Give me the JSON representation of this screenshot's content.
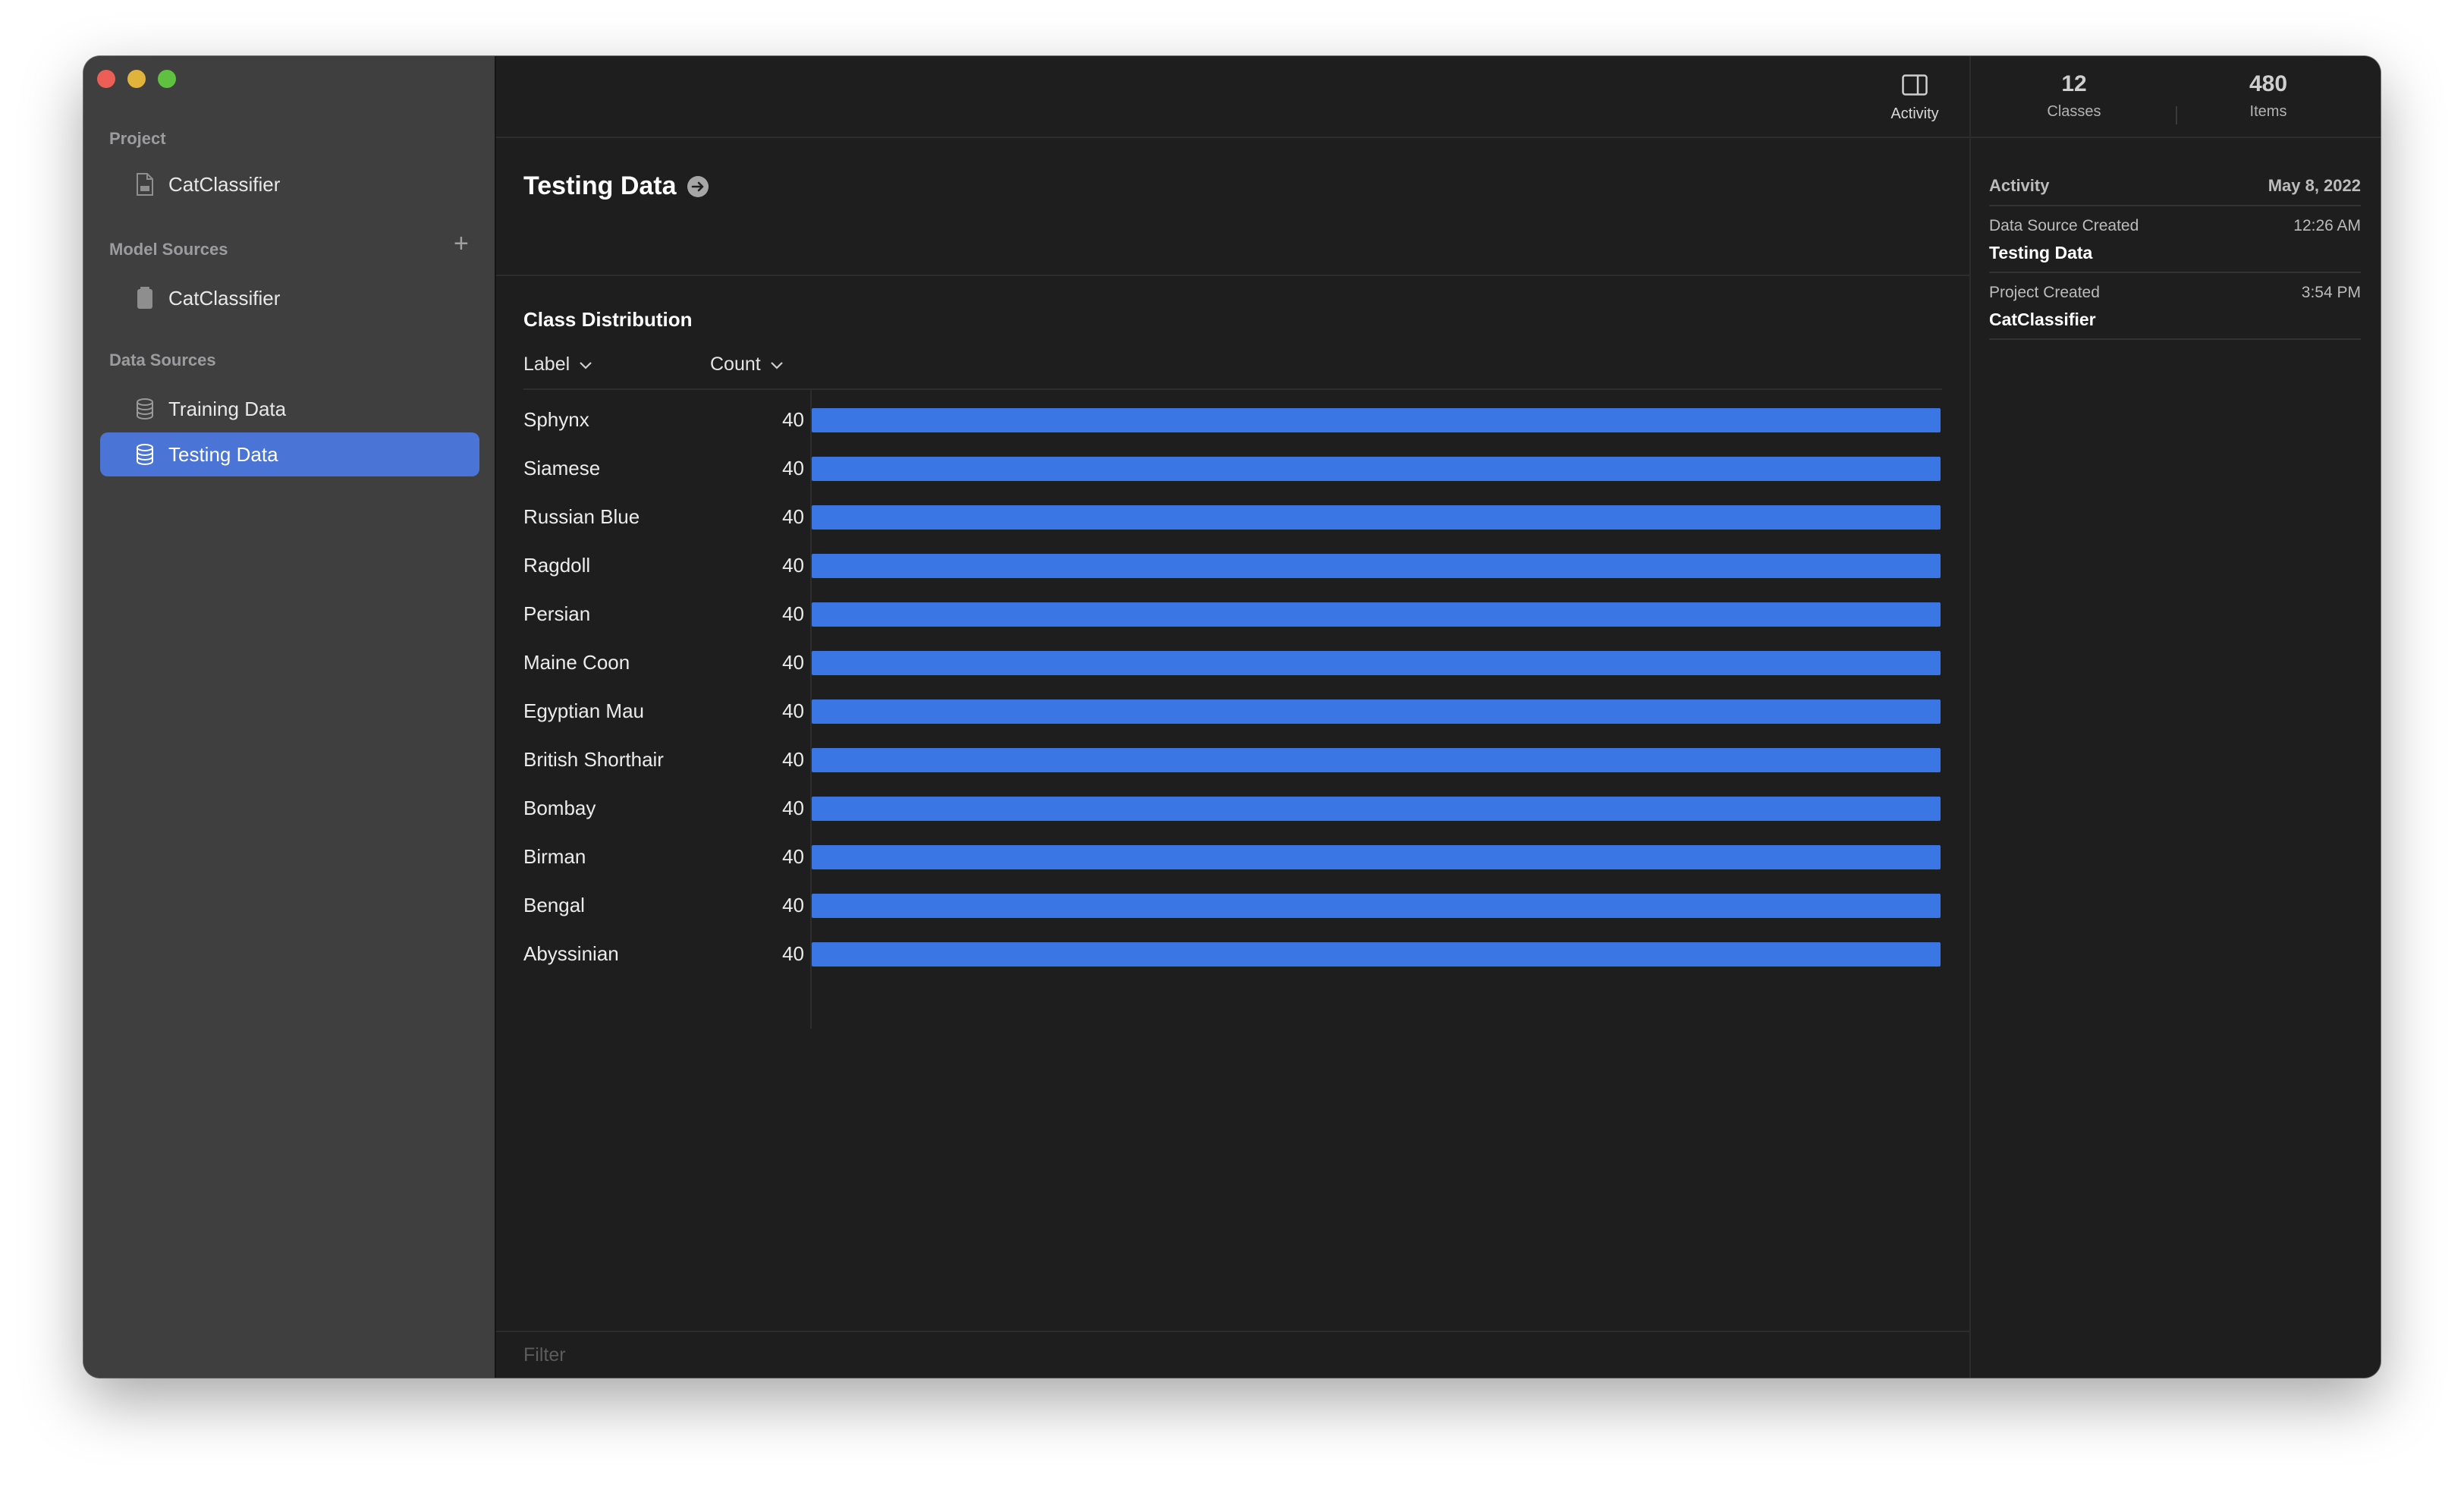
{
  "sidebar": {
    "project_title": "Project",
    "project_item": "CatClassifier",
    "model_sources_title": "Model Sources",
    "model_item": "CatClassifier",
    "data_sources_title": "Data Sources",
    "data_items": [
      {
        "label": "Training Data",
        "selected": false
      },
      {
        "label": "Testing Data",
        "selected": true
      }
    ],
    "accent_color": "#4a74d6"
  },
  "toolbar": {
    "activity_label": "Activity"
  },
  "main": {
    "title": "Testing Data",
    "distribution_title": "Class Distribution",
    "col_label": "Label",
    "col_count": "Count",
    "filter_placeholder": "Filter",
    "bar_color": "#3b76e5",
    "rows": [
      {
        "label": "Sphynx",
        "count": "40"
      },
      {
        "label": "Siamese",
        "count": "40"
      },
      {
        "label": "Russian Blue",
        "count": "40"
      },
      {
        "label": "Ragdoll",
        "count": "40"
      },
      {
        "label": "Persian",
        "count": "40"
      },
      {
        "label": "Maine Coon",
        "count": "40"
      },
      {
        "label": "Egyptian Mau",
        "count": "40"
      },
      {
        "label": "British Shorthair",
        "count": "40"
      },
      {
        "label": "Bombay",
        "count": "40"
      },
      {
        "label": "Birman",
        "count": "40"
      },
      {
        "label": "Bengal",
        "count": "40"
      },
      {
        "label": "Abyssinian",
        "count": "40"
      }
    ]
  },
  "stats": {
    "classes_value": "12",
    "classes_label": "Classes",
    "items_value": "480",
    "items_label": "Items"
  },
  "activity": {
    "title": "Activity",
    "date": "May 8, 2022",
    "entries": [
      {
        "event": "Data Source Created",
        "time": "12:26 AM",
        "name": "Testing Data"
      },
      {
        "event": "Project Created",
        "time": "3:54 PM",
        "name": "CatClassifier"
      }
    ]
  }
}
